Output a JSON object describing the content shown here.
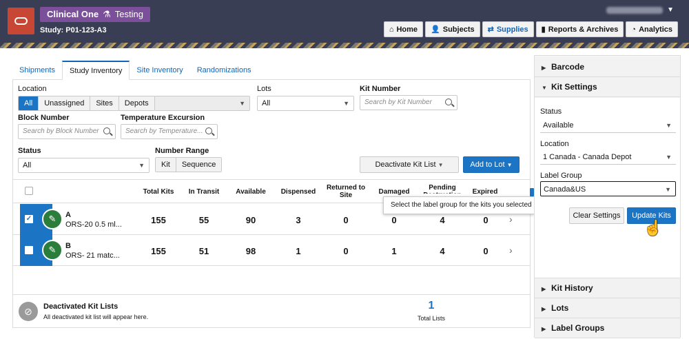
{
  "header": {
    "app_name": "Clinical One",
    "mode": "Testing",
    "study": "Study: P01-123-A3",
    "nav": [
      {
        "label": "Home",
        "icon": "home-icon"
      },
      {
        "label": "Subjects",
        "icon": "person-icon"
      },
      {
        "label": "Supplies",
        "icon": "supplies-icon",
        "active": true
      },
      {
        "label": "Reports & Archives",
        "icon": "bar-chart-icon"
      },
      {
        "label": "Analytics",
        "icon": "gauge-icon"
      }
    ]
  },
  "tabs": [
    "Shipments",
    "Study Inventory",
    "Site Inventory",
    "Randomizations"
  ],
  "filters": {
    "location_label": "Location",
    "location_options": [
      "All",
      "Unassigned",
      "Sites",
      "Depots"
    ],
    "lots_label": "Lots",
    "lots_value": "All",
    "kit_number_label": "Kit Number",
    "kit_number_placeholder": "Search by Kit Number",
    "block_number_label": "Block Number",
    "block_number_placeholder": "Search by Block Number",
    "temp_label": "Temperature Excursion",
    "temp_placeholder": "Search by Temperature...",
    "status_label": "Status",
    "status_value": "All",
    "number_range_label": "Number Range",
    "number_range_options": [
      "Kit",
      "Sequence"
    ],
    "deactivate_button": "Deactivate Kit List",
    "add_to_lot_button": "Add to Lot"
  },
  "table": {
    "headers": [
      "Total Kits",
      "In Transit",
      "Available",
      "Dispensed",
      "Returned to Site",
      "Damaged",
      "Pending Destruction",
      "Expired"
    ],
    "rows": [
      {
        "name": "A",
        "desc": "ORS-20 0.5 ml...",
        "checked": true,
        "values": [
          "155",
          "55",
          "90",
          "3",
          "0",
          "0",
          "4",
          "0"
        ]
      },
      {
        "name": "B",
        "desc": "ORS- 21 matc...",
        "checked": false,
        "values": [
          "155",
          "51",
          "98",
          "1",
          "0",
          "1",
          "4",
          "0"
        ]
      }
    ],
    "footer": {
      "title": "Deactivated Kit Lists",
      "subtitle": "All deactivated kit list will appear here.",
      "count": "1",
      "count_label": "Total Lists"
    }
  },
  "tooltip": "Select the label group for the kits you selected",
  "right_panel": {
    "barcode": "Barcode",
    "kit_settings": "Kit Settings",
    "status_label": "Status",
    "status_value": "Available",
    "location_label": "Location",
    "location_value": "1 Canada - Canada Depot",
    "label_group_label": "Label Group",
    "label_group_value": "Canada&US",
    "clear_button": "Clear Settings",
    "update_button": "Update Kits",
    "kit_history": "Kit History",
    "lots": "Lots",
    "label_groups": "Label Groups"
  },
  "colors": {
    "header_bg": "#3a3e55",
    "brand_red": "#c74634",
    "badge_purple": "#7b4f99",
    "accent_blue": "#1c74c4",
    "kit_green": "#2a7d3a"
  }
}
